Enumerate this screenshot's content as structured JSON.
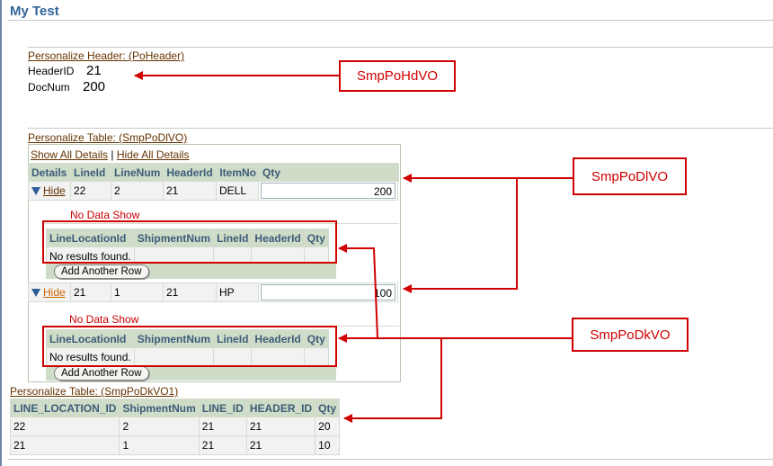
{
  "page": {
    "title": "My Test"
  },
  "header_region": {
    "personalize_link": "Personalize Header: (PoHeader)",
    "fields": [
      {
        "label": "HeaderID",
        "value": "21"
      },
      {
        "label": "DocNum",
        "value": "200"
      }
    ]
  },
  "table1": {
    "personalize_link": "Personalize Table: (SmpPoDlVO)",
    "show_all": "Show All Details",
    "separator": "|",
    "hide_all": "Hide All Details",
    "columns": [
      "Details",
      "LineId",
      "LineNum",
      "HeaderId",
      "ItemNo",
      "Qty"
    ],
    "rows": [
      {
        "hide_label": "Hide",
        "lineid": "22",
        "linenum": "2",
        "headerid": "21",
        "itemno": "DELL",
        "qty": "200",
        "no_data": "No Data Show",
        "detail_columns": [
          "LineLocationId",
          "ShipmentNum",
          "LineId",
          "HeaderId",
          "Qty"
        ],
        "empty_text": "No results found.",
        "add_row": "Add Another Row"
      },
      {
        "hide_label": "Hide",
        "lineid": "21",
        "linenum": "1",
        "headerid": "21",
        "itemno": "HP",
        "qty": "100",
        "no_data": "No Data Show",
        "detail_columns": [
          "LineLocationId",
          "ShipmentNum",
          "LineId",
          "HeaderId",
          "Qty"
        ],
        "empty_text": "No results found.",
        "add_row": "Add Another Row"
      }
    ]
  },
  "table2": {
    "personalize_link": "Personalize Table: (SmpPoDkVO1)",
    "columns": [
      "LINE_LOCATION_ID",
      "ShipmentNum",
      "LINE_ID",
      "HEADER_ID",
      "Qty"
    ],
    "rows": [
      [
        "22",
        "2",
        "21",
        "21",
        "20"
      ],
      [
        "21",
        "1",
        "21",
        "21",
        "10"
      ]
    ]
  },
  "callouts": {
    "header": "SmpPoHdVO",
    "lines": "SmpPoDlVO",
    "shipments": "SmpPoDkVO"
  },
  "colors": {
    "annotation": "#d10000",
    "header_blue": "#336699",
    "link_brown": "#663300"
  }
}
